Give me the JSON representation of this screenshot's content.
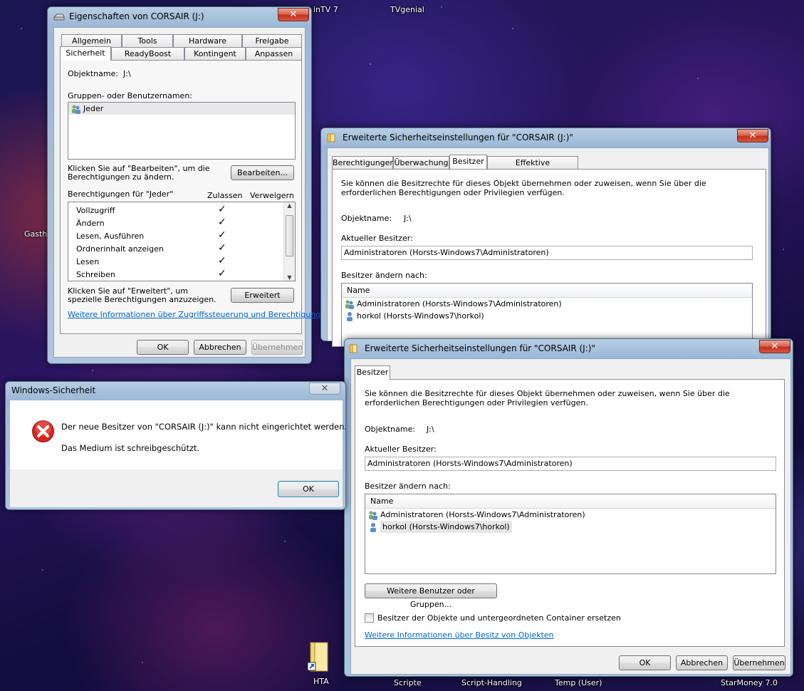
{
  "desktop": {
    "labels": [
      "inTV 7",
      "TVgenial",
      "Gasth",
      "HTA",
      "Scripte",
      "Script-Handling",
      "Temp (User)",
      "StarMoney 7.0"
    ]
  },
  "props": {
    "title": "Eigenschaften von CORSAIR (J:)",
    "tabs_row1": [
      "Allgemein",
      "Tools",
      "Hardware",
      "Freigabe"
    ],
    "tabs_row2": [
      "Sicherheit",
      "ReadyBoost",
      "Kontingent",
      "Anpassen"
    ],
    "objektname_label": "Objektname:",
    "objektname_value": "J:\\",
    "groups_label": "Gruppen- oder Benutzernamen:",
    "groups": [
      "Jeder"
    ],
    "edit_hint": "Klicken Sie auf \"Bearbeiten\", um die Berechtigungen zu ändern.",
    "edit_button": "Bearbeiten...",
    "perm_for": "Berechtigungen für \"Jeder\"",
    "col_allow": "Zulassen",
    "col_deny": "Verweigern",
    "permissions": [
      "Vollzugriff",
      "Ändern",
      "Lesen, Ausführen",
      "Ordnerinhalt anzeigen",
      "Lesen",
      "Schreiben"
    ],
    "adv_hint": "Klicken Sie auf \"Erweitert\", um spezielle Berechtigungen anzuzeigen.",
    "adv_button": "Erweitert",
    "link": "Weitere Informationen über Zugriffssteuerung und Berechtigungen",
    "ok": "OK",
    "cancel": "Abbrechen",
    "apply": "Übernehmen"
  },
  "adv1": {
    "title": "Erweiterte Sicherheitseinstellungen für \"CORSAIR (J:)\"",
    "tabs": [
      "Berechtigungen",
      "Überwachung",
      "Besitzer",
      "Effektive Berechtigungen"
    ],
    "intro": "Sie können die Besitzrechte für dieses Objekt übernehmen oder zuweisen, wenn Sie über die erforderlichen Berechtigungen oder Privilegien verfügen.",
    "objektname_label": "Objektname:",
    "objektname_value": "J:\\",
    "current_owner_label": "Aktueller Besitzer:",
    "current_owner": "Administratoren (Horsts-Windows7\\Administratoren)",
    "change_label": "Besitzer ändern nach:",
    "col_name": "Name",
    "owners": [
      "Administratoren (Horsts-Windows7\\Administratoren)",
      "horkol (Horsts-Windows7\\horkol)"
    ]
  },
  "adv2": {
    "title": "Erweiterte Sicherheitseinstellungen für \"CORSAIR (J:)\"",
    "tab": "Besitzer",
    "intro": "Sie können die Besitzrechte für dieses Objekt übernehmen oder zuweisen, wenn Sie über die erforderlichen Berechtigungen oder Privilegien verfügen.",
    "objektname_label": "Objektname:",
    "objektname_value": "J:\\",
    "current_owner_label": "Aktueller Besitzer:",
    "current_owner": "Administratoren (Horsts-Windows7\\Administratoren)",
    "change_label": "Besitzer ändern nach:",
    "col_name": "Name",
    "owners": [
      "Administratoren (Horsts-Windows7\\Administratoren)",
      "horkol (Horsts-Windows7\\horkol)"
    ],
    "more_button": "Weitere Benutzer oder Gruppen...",
    "replace_label": "Besitzer der Objekte und untergeordneten Container ersetzen",
    "link": "Weitere Informationen über Besitz von Objekten",
    "ok": "OK",
    "cancel": "Abbrechen",
    "apply": "Übernehmen"
  },
  "msgbox": {
    "title": "Windows-Sicherheit",
    "line1": "Der neue Besitzer von \"CORSAIR (J:)\" kann nicht eingerichtet werden.",
    "line2": "Das Medium ist schreibgeschützt.",
    "ok": "OK"
  },
  "colors": {
    "link": "#0066cc",
    "error": "#d8251c"
  }
}
